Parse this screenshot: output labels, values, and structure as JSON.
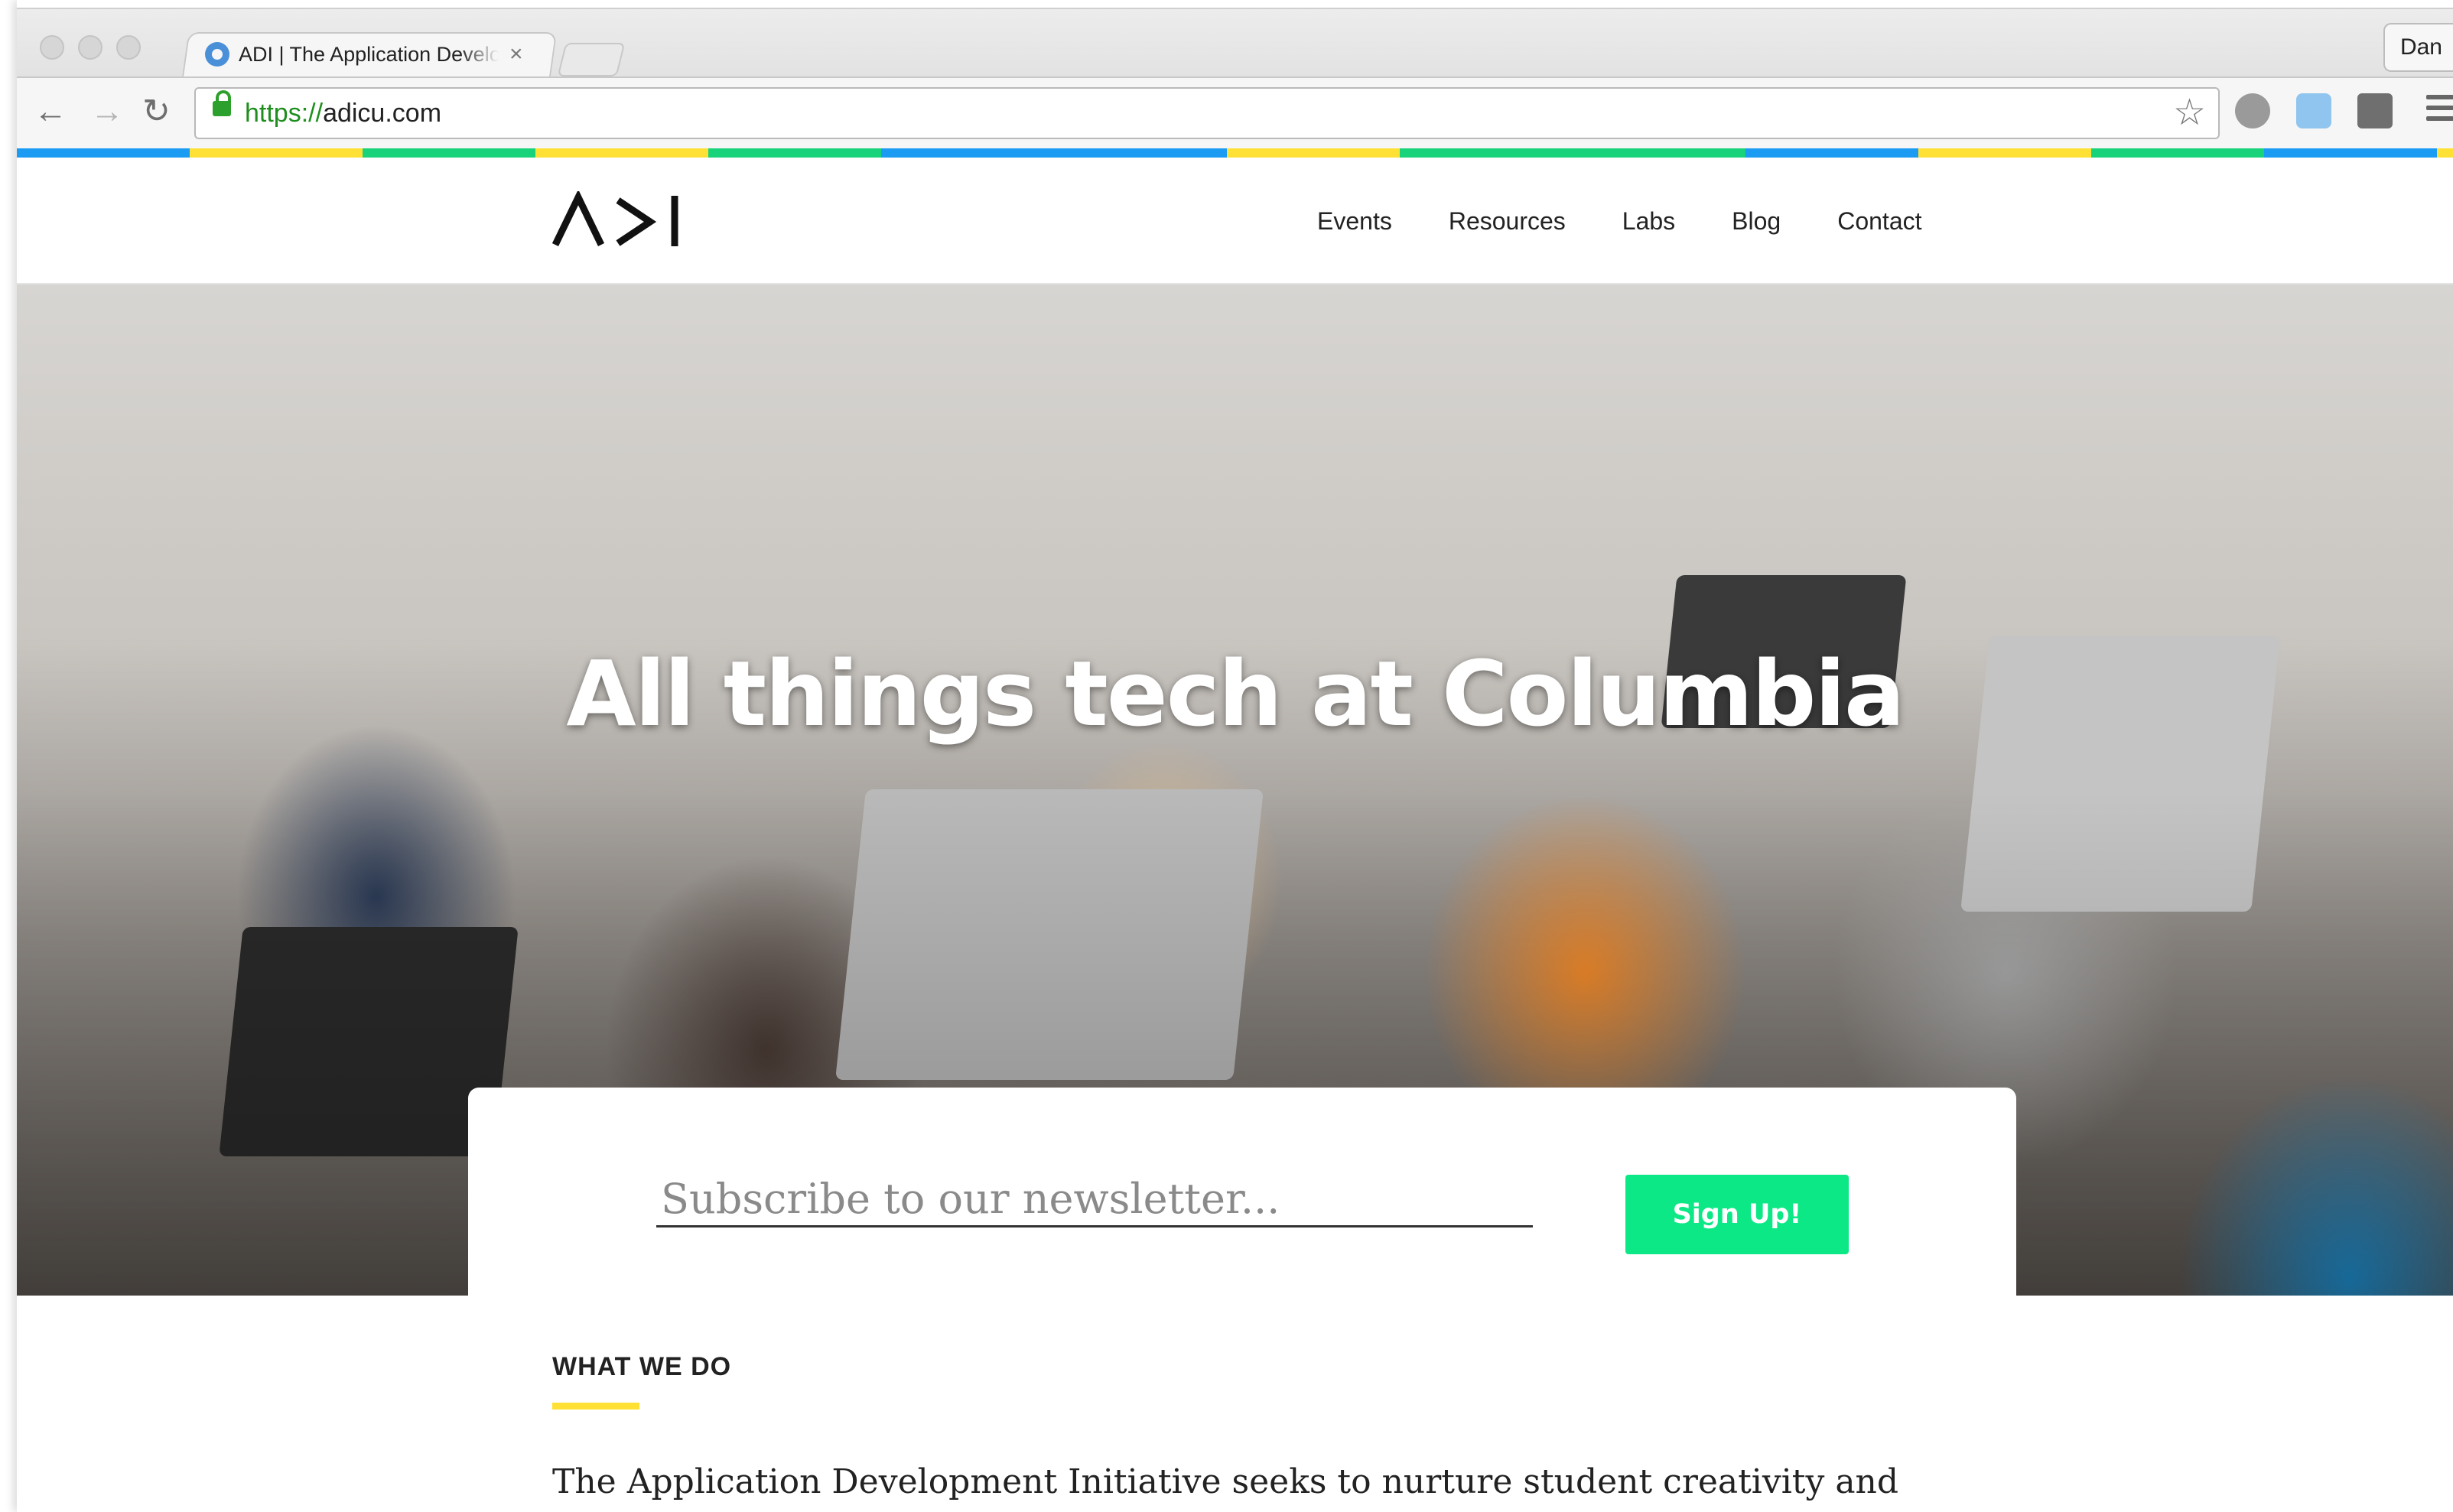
{
  "browser": {
    "tab_title": "ADI | The Application Development Initiative",
    "tab_close": "×",
    "profile_name": "Dan",
    "url_scheme": "https://",
    "url_host": "adicu.com",
    "nav_back": "←",
    "nav_forward": "→",
    "nav_reload": "↻",
    "star": "☆"
  },
  "colors": {
    "bar": [
      "#1b9bf2",
      "#ffe135",
      "#18d37a",
      "#ffe135",
      "#18d37a",
      "#1b9bf2",
      "#1b9bf2",
      "#ffe135",
      "#18d37a",
      "#18d37a",
      "#1b9bf2",
      "#ffe135",
      "#18d37a",
      "#1b9bf2",
      "#ffe135"
    ],
    "accent_green": "#0de886",
    "accent_yellow": "#ffe135"
  },
  "site": {
    "logo_alt": "ADI",
    "nav": [
      {
        "label": "Events"
      },
      {
        "label": "Resources"
      },
      {
        "label": "Labs"
      },
      {
        "label": "Blog"
      },
      {
        "label": "Contact"
      }
    ],
    "hero_title": "All things tech at Columbia",
    "newsletter": {
      "placeholder": "Subscribe to our newsletter...",
      "button": "Sign Up!"
    },
    "section": {
      "label": "WHAT WE DO",
      "text": "The Application Development Initiative seeks to nurture student creativity and"
    }
  }
}
